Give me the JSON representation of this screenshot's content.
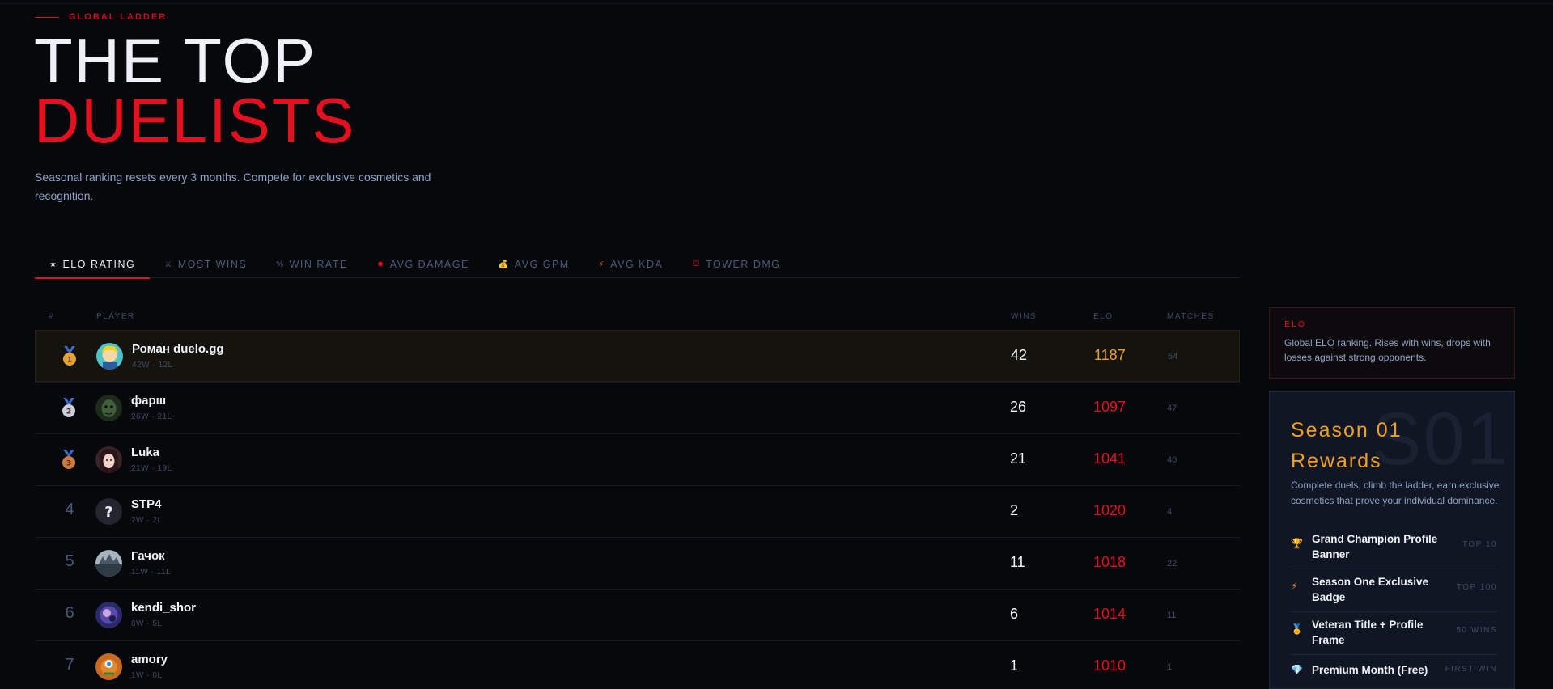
{
  "header": {
    "eyebrow": "GLOBAL LADDER",
    "title_line1": "THE TOP",
    "title_line2": "DUELISTS",
    "subtitle": "Seasonal ranking resets every 3 months. Compete for exclusive cosmetics and recognition."
  },
  "tabs": [
    {
      "label": "ELO RATING",
      "icon": "star-icon",
      "glyph": "★",
      "active": true
    },
    {
      "label": "MOST WINS",
      "icon": "swords-icon",
      "glyph": "⚔"
    },
    {
      "label": "WIN RATE",
      "icon": "percent-icon",
      "glyph": "%"
    },
    {
      "label": "AVG DAMAGE",
      "icon": "burst-icon",
      "glyph": "✸"
    },
    {
      "label": "AVG GPM",
      "icon": "money-bag-icon",
      "glyph": "💰"
    },
    {
      "label": "AVG KDA",
      "icon": "lightning-icon",
      "glyph": "⚡"
    },
    {
      "label": "TOWER DMG",
      "icon": "tower-icon",
      "glyph": "⛫"
    }
  ],
  "table": {
    "headers": {
      "rank": "#",
      "player": "PLAYER",
      "wins": "WINS",
      "elo": "ELO",
      "matches": "MATCHES"
    },
    "rows": [
      {
        "rank": "1",
        "medal": "gold",
        "name": "Роман duelo.gg",
        "record": "42W · 12L",
        "wins": "42",
        "elo": "1187",
        "matches": "54"
      },
      {
        "rank": "2",
        "medal": "silver",
        "name": "фарш",
        "record": "26W · 21L",
        "wins": "26",
        "elo": "1097",
        "matches": "47"
      },
      {
        "rank": "3",
        "medal": "bronze",
        "name": "Luka",
        "record": "21W · 19L",
        "wins": "21",
        "elo": "1041",
        "matches": "40"
      },
      {
        "rank": "4",
        "name": "STP4",
        "record": "2W · 2L",
        "wins": "2",
        "elo": "1020",
        "matches": "4"
      },
      {
        "rank": "5",
        "name": "Гачок",
        "record": "11W · 11L",
        "wins": "11",
        "elo": "1018",
        "matches": "22"
      },
      {
        "rank": "6",
        "name": "kendi_shor",
        "record": "6W · 5L",
        "wins": "6",
        "elo": "1014",
        "matches": "11"
      },
      {
        "rank": "7",
        "name": "amory",
        "record": "1W · 0L",
        "wins": "1",
        "elo": "1010",
        "matches": "1"
      }
    ]
  },
  "elo_info": {
    "title": "ELO",
    "description": "Global ELO ranking. Rises with wins, drops with losses against strong opponents."
  },
  "season": {
    "bg_text": "S01",
    "title": "Season 01 Rewards",
    "description": "Complete duels, climb the ladder, earn exclusive cosmetics that prove your individual dominance.",
    "rewards": [
      {
        "icon": "trophy-icon",
        "glyph": "🏆",
        "title": "Grand Champion Profile Banner",
        "req": "TOP 10"
      },
      {
        "icon": "lightning-icon",
        "glyph": "⚡",
        "title": "Season One Exclusive Badge",
        "req": "TOP 100"
      },
      {
        "icon": "medal-icon",
        "glyph": "🏅",
        "title": "Veteran Title + Profile Frame",
        "req": "50 WINS"
      },
      {
        "icon": "diamond-icon",
        "glyph": "💎",
        "title": "Premium Month (Free)",
        "req": "FIRST WIN"
      }
    ]
  },
  "colors": {
    "accent": "#e3101f",
    "gold": "#f0a020",
    "muted": "#8ea4c8",
    "bg": "#07080c"
  }
}
